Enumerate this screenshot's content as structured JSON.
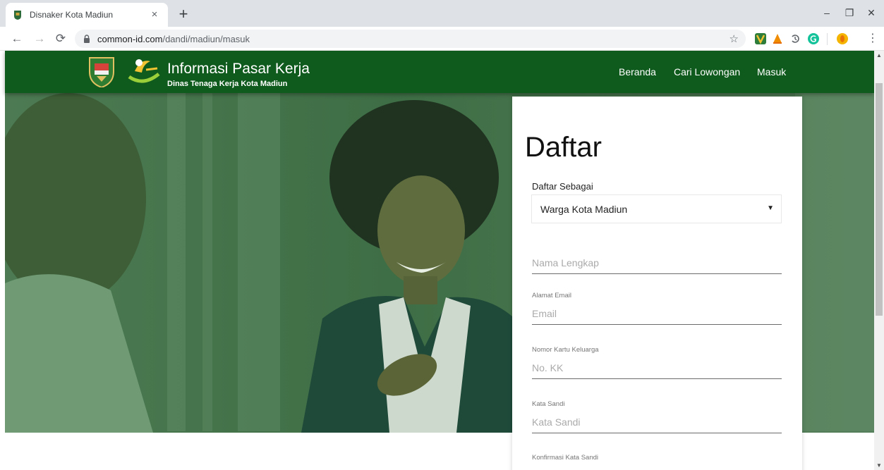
{
  "browser": {
    "tab_title": "Disnaker Kota Madiun",
    "tab_close": "×",
    "new_tab": "+",
    "url_host": "common-id.com",
    "url_path": "/dandi/madiun/masuk",
    "window_controls": {
      "minimize": "–",
      "restore": "❐",
      "close": "✕"
    },
    "nav": {
      "back": "←",
      "forward": "→",
      "reload": "⟳"
    },
    "star": "☆",
    "menu": "⋮",
    "extension_icons": [
      "ext-vim-icon",
      "ext-vlc-icon",
      "ext-history-icon",
      "ext-grammarly-icon",
      "ext-profile-icon"
    ]
  },
  "site": {
    "brand_title": "Informasi Pasar Kerja",
    "brand_subtitle": "Dinas Tenaga Kerja Kota Madiun",
    "nav": [
      "Beranda",
      "Cari Lowongan",
      "Masuk"
    ],
    "colors": {
      "navbar": "#0f5a1d",
      "hero_tint": "#2f5a36"
    }
  },
  "form": {
    "title": "Daftar",
    "register_as_label": "Daftar Sebagai",
    "register_as_value": "Warga Kota Madiun",
    "select_caret": "▼",
    "full_name_placeholder": "Nama Lengkap",
    "email_label": "Alamat Email",
    "email_placeholder": "Email",
    "kk_label": "Nomor Kartu Keluarga",
    "kk_placeholder": "No. KK",
    "password_label": "Kata Sandi",
    "password_placeholder": "Kata Sandi",
    "confirm_label": "Konfirmasi Kata Sandi"
  }
}
